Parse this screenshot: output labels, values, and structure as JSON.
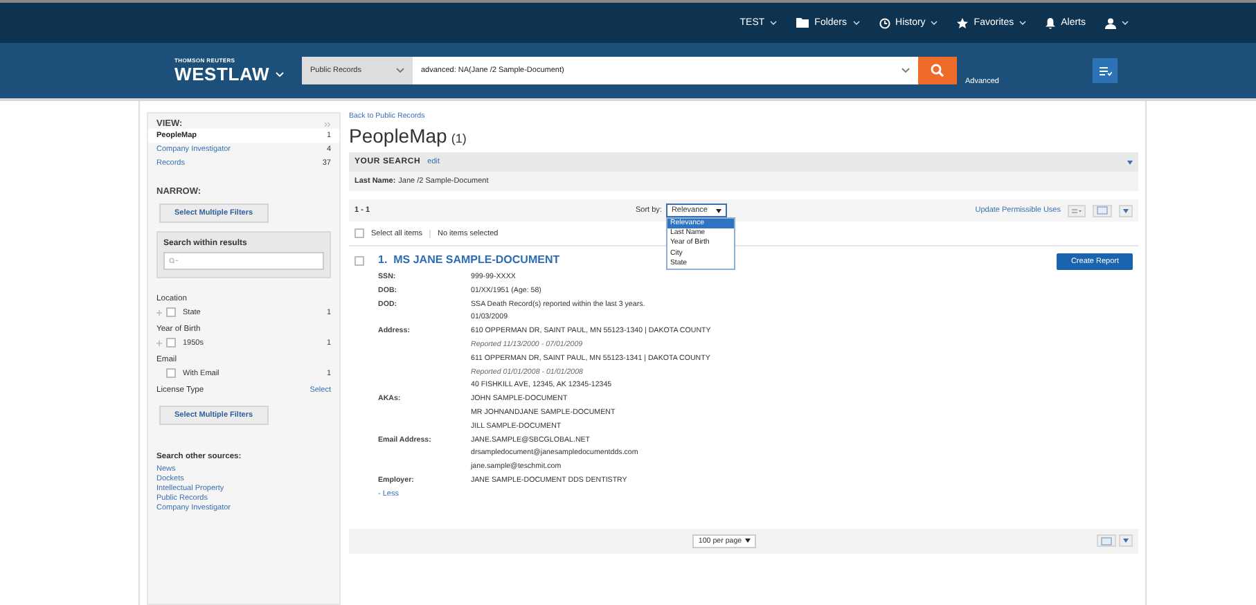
{
  "top_nav": [
    {
      "kind": "text",
      "label": "TEST",
      "caret": true
    },
    {
      "kind": "folder",
      "label": "Folders",
      "caret": true
    },
    {
      "kind": "history",
      "label": "History",
      "caret": true
    },
    {
      "kind": "star",
      "label": "Favorites",
      "caret": true
    },
    {
      "kind": "bell",
      "label": "Alerts",
      "caret": false
    },
    {
      "kind": "user",
      "caret": true
    }
  ],
  "brand": {
    "company": "THOMSON REUTERS",
    "name": "WESTLAW"
  },
  "search": {
    "category": "Public Records",
    "query": "advanced: NA(Jane /2 Sample-Document)",
    "advanced": "Advanced"
  },
  "sidebar": {
    "view_title": "VIEW:",
    "view_items": [
      {
        "label": "PeopleMap",
        "count": "1",
        "selected": true
      },
      {
        "label": "Company Investigator",
        "count": "4",
        "selected": false
      },
      {
        "label": "Records",
        "count": "37",
        "selected": false
      }
    ],
    "narrow_title": "NARROW:",
    "select_multiple": "Select Multiple Filters",
    "search_within": "Search within results",
    "filters": [
      {
        "title": "Location",
        "items": [
          {
            "label": "State",
            "count": "1",
            "expandable": true,
            "checked": false
          }
        ]
      },
      {
        "title": "Year of Birth",
        "items": [
          {
            "label": "1950s",
            "count": "1",
            "expandable": true,
            "checked": false
          }
        ]
      },
      {
        "title": "Email",
        "items": [
          {
            "label": "With Email",
            "count": "1",
            "expandable": false,
            "checked": false
          }
        ]
      },
      {
        "title": "License Type",
        "action": "Select",
        "button": "Select Multiple Filters"
      }
    ],
    "other_title": "Search other sources:",
    "other_links": [
      "News",
      "Dockets",
      "Intellectual Property",
      "Public Records",
      "Company Investigator"
    ]
  },
  "main": {
    "back_link": "Back to Public Records",
    "title": "PeopleMap",
    "count": "(1)",
    "your_search": {
      "title": "YOUR SEARCH",
      "edit": "edit",
      "criteria_label": "Last Name:",
      "criteria_value": "Jane /2 Sample-Document"
    },
    "range": "1 - 1",
    "sort_label": "Sort by:",
    "sort_value": "Relevance",
    "sort_options": [
      {
        "label": "Relevance",
        "selected": true
      },
      {
        "label": "Last Name",
        "selected": false
      },
      {
        "label": "Year of Birth",
        "selected": false
      },
      {
        "label": "City",
        "selected": false
      },
      {
        "label": "State",
        "selected": false
      }
    ],
    "update_link": "Update Permissible Uses",
    "select_all": "Select all items",
    "select_all_checked": false,
    "selection_status": "No items selected",
    "result": {
      "number": "1.",
      "name": "MS JANE SAMPLE-DOCUMENT",
      "checked": false,
      "create_report": "Create Report",
      "fields": [
        {
          "label": "SSN:",
          "values": [
            {
              "kind": "plain",
              "text": "999-99-XXXX"
            }
          ]
        },
        {
          "label": "DOB:",
          "values": [
            {
              "kind": "plain",
              "text": "01/XX/1951 (Age: 58)"
            }
          ]
        },
        {
          "label": "DOD:",
          "values": [
            {
              "kind": "plain",
              "text": "SSA Death Record(s) reported within the last 3 years."
            },
            {
              "kind": "plain",
              "text": "01/03/2009"
            }
          ]
        },
        {
          "label": "Address:",
          "values": [
            {
              "kind": "plain",
              "text": "610 OPPERMAN DR, SAINT PAUL, MN 55123-1340 | DAKOTA COUNTY"
            },
            {
              "kind": "reported",
              "text": "Reported 11/13/2000 - 07/01/2009"
            },
            {
              "kind": "plain",
              "text": "611 OPPERMAN DR, SAINT PAUL, MN 55123-1341 | DAKOTA COUNTY"
            },
            {
              "kind": "reported",
              "text": "Reported 01/01/2008 - 01/01/2008"
            },
            {
              "kind": "plain",
              "text": "40 FISHKILL AVE, 12345, AK 12345-12345"
            }
          ]
        },
        {
          "label": "AKAs:",
          "values": [
            {
              "kind": "plain",
              "text": "JOHN SAMPLE-DOCUMENT"
            },
            {
              "kind": "plain",
              "text": "MR JOHNANDJANE SAMPLE-DOCUMENT"
            },
            {
              "kind": "plain",
              "text": "JILL SAMPLE-DOCUMENT"
            }
          ]
        },
        {
          "label": "Email Address:",
          "values": [
            {
              "kind": "plain",
              "text": "JANE.SAMPLE@SBCGLOBAL.NET"
            },
            {
              "kind": "plain",
              "text": "drsampledocument@janesampledocumentdds.com"
            },
            {
              "kind": "plain",
              "text": "jane.sample@teschmit.com"
            }
          ]
        },
        {
          "label": "Employer:",
          "values": [
            {
              "kind": "plain",
              "text": "JANE SAMPLE-DOCUMENT DDS DENTISTRY"
            }
          ]
        }
      ],
      "less": "- Less"
    },
    "per_page": "100 per page"
  }
}
